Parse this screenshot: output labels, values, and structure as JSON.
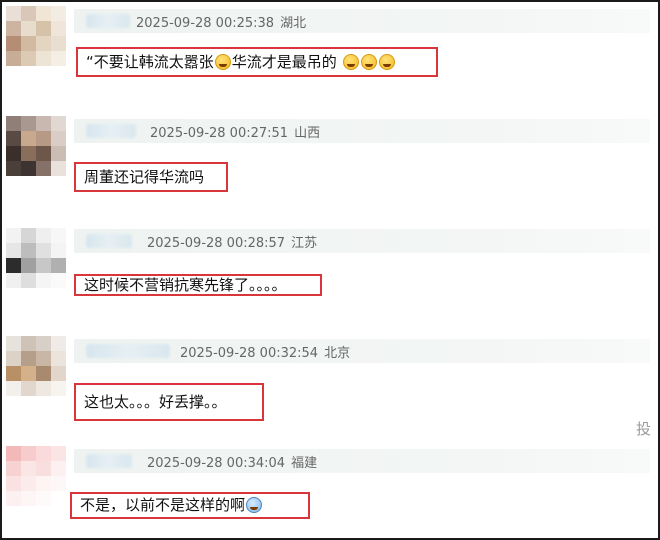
{
  "comments": [
    {
      "time": "2025-09-28 00:25:38",
      "location": "湖北",
      "content": "“不要让韩流太嚣张",
      "content_after": "华流才是最吊的",
      "emojis_inline": [
        "grin-squint-emoji"
      ],
      "emojis_trailing": [
        "laugh-squint-emoji",
        "laugh-squint-emoji",
        "laugh-squint-emoji"
      ]
    },
    {
      "time": "2025-09-28 00:27:51",
      "location": "山西",
      "content": "周董还记得华流吗"
    },
    {
      "time": "2025-09-28 00:28:57",
      "location": "江苏",
      "content": "这时候不营销抗寒先锋了。。。。"
    },
    {
      "time": "2025-09-28 00:32:54",
      "location": "北京",
      "content": "这也太。。。好丢撑。。"
    },
    {
      "time": "2025-09-28 00:34:04",
      "location": "福建",
      "content": "不是，以前不是这样的啊",
      "emojis_trailing": [
        "fearful-face-emoji"
      ]
    }
  ],
  "side_label": "投",
  "colors": {
    "highlight_border": "#d8363b",
    "meta_bar": "#eef3f1",
    "meta_text": "#666666"
  }
}
